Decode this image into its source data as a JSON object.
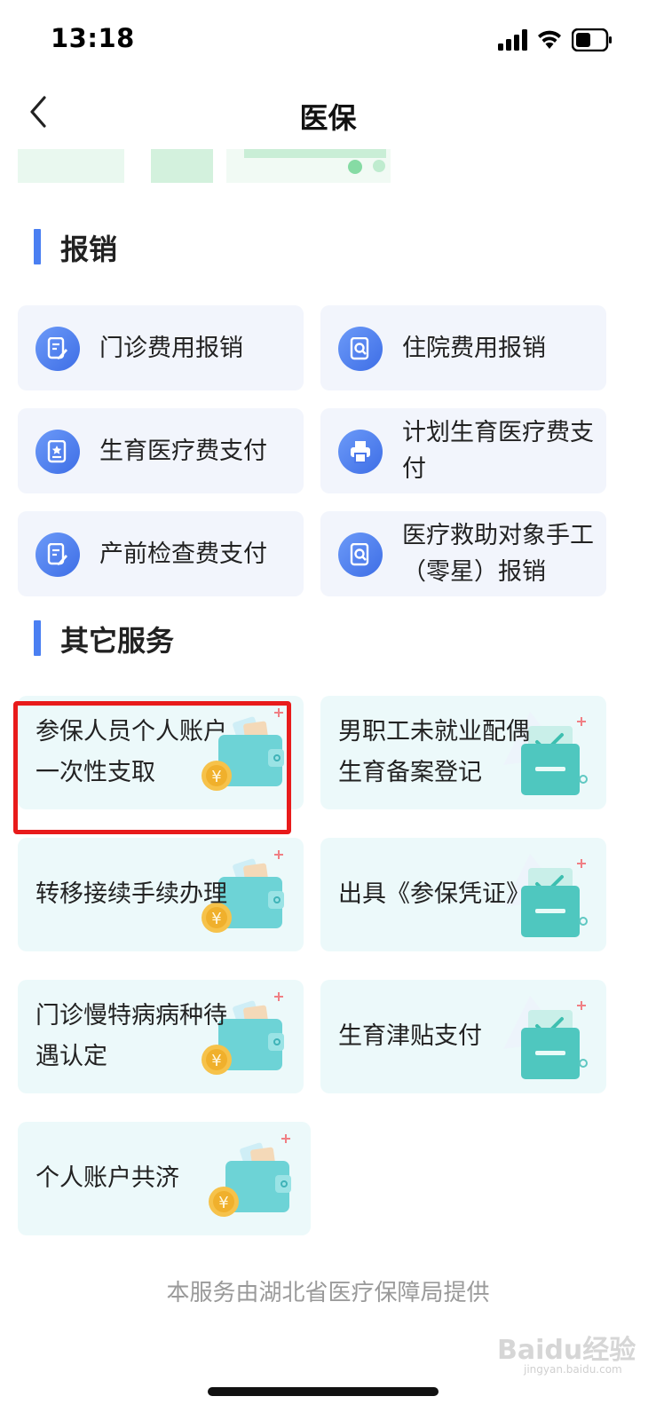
{
  "status_bar": {
    "time": "13:18"
  },
  "nav": {
    "title": "医保"
  },
  "sections": {
    "reimbursement": {
      "title": "报销"
    },
    "other": {
      "title": "其它服务"
    }
  },
  "reimbursement_items": [
    {
      "label": "门诊费用报销",
      "icon": "edit-document-icon"
    },
    {
      "label": "住院费用报销",
      "icon": "document-search-icon"
    },
    {
      "label": "生育医疗费支付",
      "icon": "star-document-icon"
    },
    {
      "label": "计划生育医疗费支付",
      "icon": "printer-icon"
    },
    {
      "label": "产前检查费支付",
      "icon": "edit-document-icon"
    },
    {
      "label": "医疗救助对象手工（零星）报销",
      "icon": "document-search-icon"
    }
  ],
  "service_items": [
    {
      "label": "参保人员个人账户一次性支取",
      "icon": "wallet-coin-icon"
    },
    {
      "label": "男职工未就业配偶生育备案登记",
      "icon": "checked-box-icon"
    },
    {
      "label": "转移接续手续办理",
      "icon": "wallet-coin-icon"
    },
    {
      "label": "出具《参保凭证》",
      "icon": "checked-box-icon"
    },
    {
      "label": "门诊慢特病病种待遇认定",
      "icon": "wallet-coin-icon"
    },
    {
      "label": "生育津贴支付",
      "icon": "checked-box-icon"
    },
    {
      "label": "个人账户共济",
      "icon": "wallet-coin-icon"
    }
  ],
  "footer": {
    "text": "本服务由湖北省医疗保障局提供"
  },
  "watermark": {
    "text": "Baidu经验",
    "sub": "jingyan.baidu.com"
  },
  "colors": {
    "accent": "#4a7ff2",
    "highlight": "#e81b1b",
    "service_bg": "#ecf9fa",
    "card_bg": "#f2f5fc"
  }
}
